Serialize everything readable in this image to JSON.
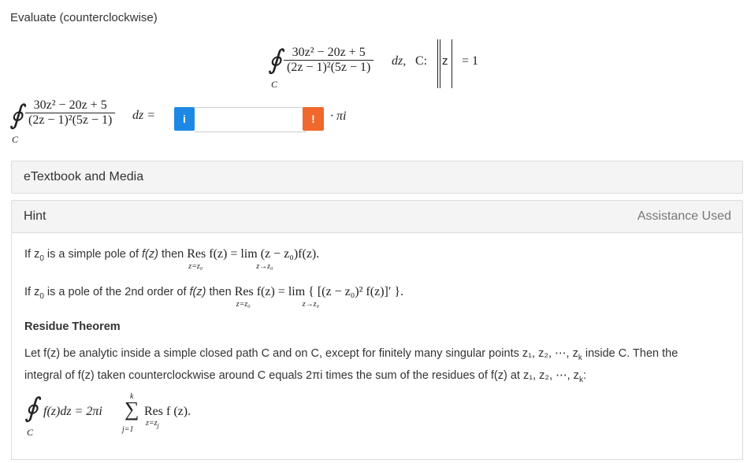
{
  "instruction": "Evaluate (counterclockwise)",
  "problem": {
    "numerator": "30z² − 20z + 5",
    "denominator": "(2z − 1)²(5z − 1)",
    "suffix": "dz,",
    "contour_label": "C:",
    "contour_var": "z",
    "contour_eq": "= 1",
    "contour_sub": "C"
  },
  "answer_row": {
    "numerator": "30z² − 20z + 5",
    "denominator": "(2z − 1)²(5z − 1)",
    "suffix": "dz =",
    "info_label": "i",
    "input_value": "",
    "warn_label": "!",
    "pi_suffix": "· πi",
    "contour_sub": "C"
  },
  "etextbook": {
    "label": "eTextbook and Media"
  },
  "hint": {
    "title": "Hint",
    "status": "Assistance Used",
    "simple_pole_prefix": "If z",
    "simple_pole_sub": "0",
    "simple_pole_mid": " is a simple pole of ",
    "simple_pole_fz": "f(z)",
    "simple_pole_then": " then ",
    "simple_pole_formula": "Res f(z) = lim (z − z₀)f(z).",
    "simple_pole_under_res": "z=z₀",
    "simple_pole_under_lim": "z→z₀",
    "second_order_prefix": "If z",
    "second_order_sub": "0",
    "second_order_mid": " is a pole of the 2nd order of ",
    "second_order_fz": "f(z)",
    "second_order_then": " then ",
    "second_order_formula": "Res f(z) = lim { [(z − z₀)² f(z)]′ }.",
    "second_order_under_res": "z=z₀",
    "second_order_under_lim": "z→z₀",
    "theorem_title": "Residue Theorem",
    "theorem_text_1": "Let f(z) be analytic inside a simple closed path C and on C, except for finitely many singular points z₁, z₂, ⋯, z",
    "theorem_text_1_sub": "k",
    "theorem_text_1_end": " inside C. Then the",
    "theorem_text_2": "integral of f(z) taken counterclockwise around C equals 2πi times the sum of the residues of f(z) at z₁, z₂, ⋯, z",
    "theorem_text_2_sub": "k",
    "theorem_text_2_end": ":",
    "theorem_formula_left": "f(z)dz = 2πi",
    "theorem_sum_top": "k",
    "theorem_sum_bottom": "j=1",
    "theorem_formula_right": "Res f (z).",
    "theorem_res_under": "z=z",
    "theorem_res_under_sub": "j",
    "theorem_contour": "C"
  }
}
